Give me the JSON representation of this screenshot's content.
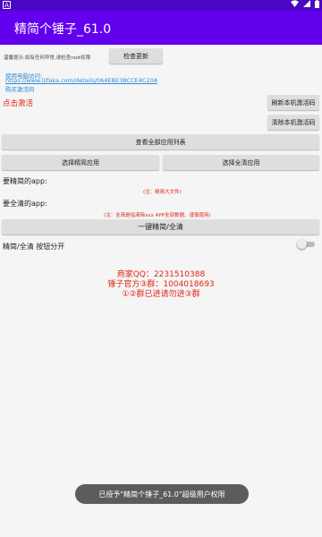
{
  "status_bar": {
    "left_icon": "A",
    "wifi_icon": "wifi-icon",
    "signal_icon": "signal-icon",
    "battery_icon": "battery-icon"
  },
  "app_bar": {
    "title": "精简个锤子_61.0"
  },
  "top": {
    "tip": "温馨提示:如有任何异常,请检查root权限",
    "check_update": "检查更新",
    "visit_label": "使用电脑访问:",
    "link": "https://www.ljlfaka.com/details/064EBE3BCCE4C20A",
    "buy": "购买激活码",
    "activate": "点击激活",
    "refresh_code": "刷新本机激活码",
    "clear_code": "清除本机激活码"
  },
  "actions": {
    "view_all": "查看全部应用列表",
    "select_slim": "选择精简应用",
    "select_clean": "选择全清应用"
  },
  "sections": {
    "slim_label": "要精简的app:",
    "slim_note": "(注：精简大文件)",
    "clean_label": "要全清的app:",
    "clean_note": "(注：全清是指清除xxx APP全部数据，谨慎使用)",
    "one_key": "一键精简/全清",
    "toggle_label": "精简/全清 按钮分开"
  },
  "contact": {
    "line1": "商家QQ：2231510388",
    "line2": "锤子官方③群：1004018693",
    "line3": "①②群已进请勿进③群"
  },
  "toast": "已授予\"精简个锤子_61.0\"超级用户权限",
  "colors": {
    "appbar": "#6200ee",
    "statusbar": "#4b08c4",
    "red": "#e0261a",
    "link": "#2e8bd8"
  }
}
